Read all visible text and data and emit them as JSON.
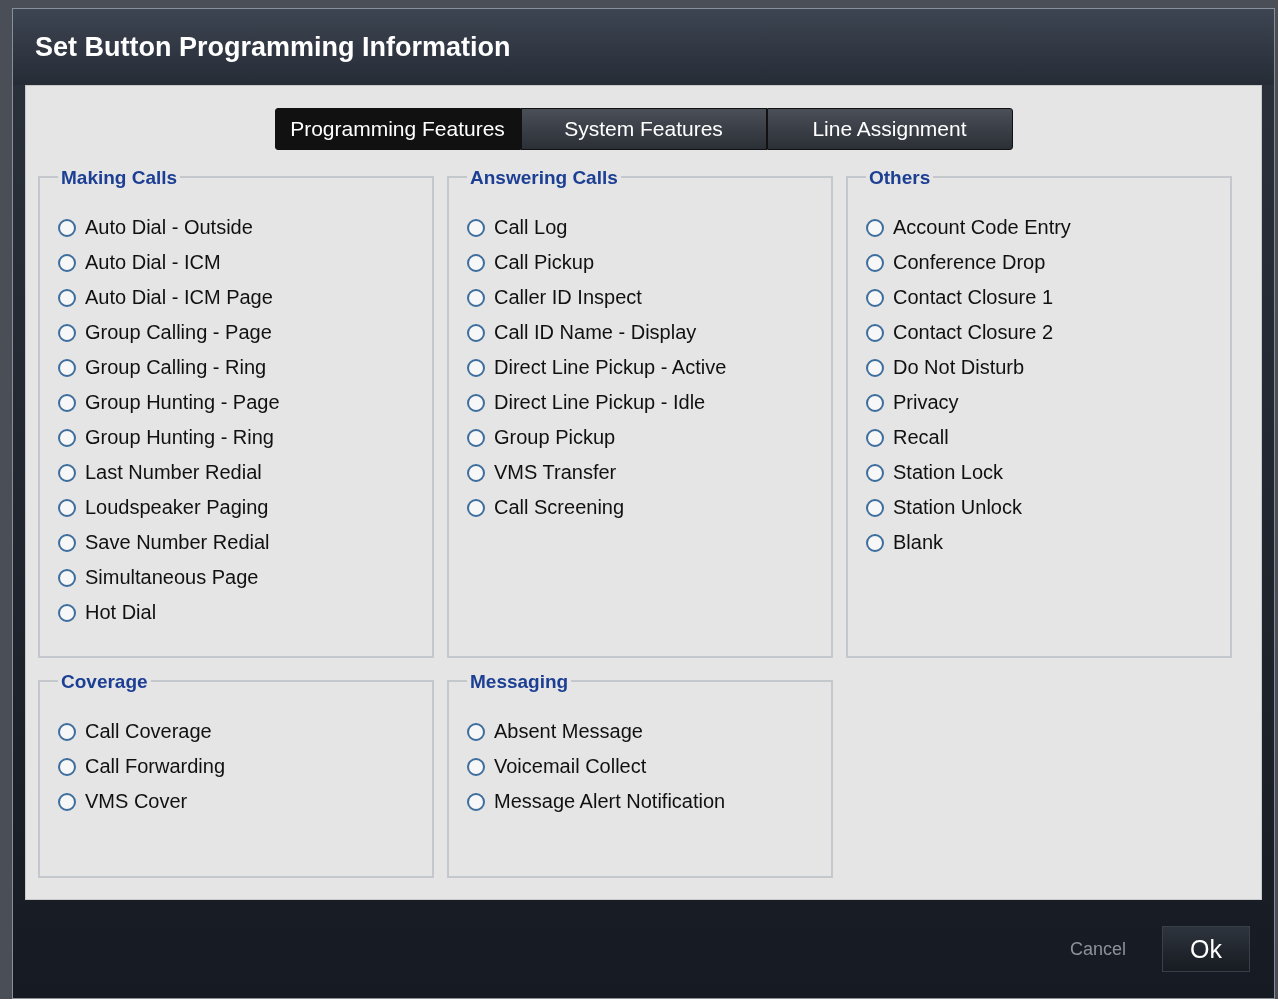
{
  "dialog": {
    "title": "Set Button Programming Information"
  },
  "tabs": [
    {
      "label": "Programming Features",
      "selected": true
    },
    {
      "label": "System Features",
      "selected": false
    },
    {
      "label": "Line Assignment",
      "selected": false
    }
  ],
  "groups": [
    {
      "title": "Making Calls",
      "options": [
        {
          "label": "Auto Dial - Outside",
          "selected": false
        },
        {
          "label": "Auto Dial - ICM",
          "selected": false
        },
        {
          "label": "Auto Dial - ICM Page",
          "selected": false
        },
        {
          "label": "Group Calling - Page",
          "selected": false
        },
        {
          "label": "Group Calling - Ring",
          "selected": false
        },
        {
          "label": "Group Hunting - Page",
          "selected": false
        },
        {
          "label": "Group Hunting - Ring",
          "selected": false
        },
        {
          "label": "Last Number Redial",
          "selected": false
        },
        {
          "label": "Loudspeaker Paging",
          "selected": false
        },
        {
          "label": "Save Number Redial",
          "selected": false
        },
        {
          "label": "Simultaneous Page",
          "selected": false
        },
        {
          "label": "Hot Dial",
          "selected": false
        }
      ]
    },
    {
      "title": "Answering Calls",
      "options": [
        {
          "label": "Call Log",
          "selected": false
        },
        {
          "label": "Call Pickup",
          "selected": false
        },
        {
          "label": "Caller ID Inspect",
          "selected": false
        },
        {
          "label": "Call ID Name - Display",
          "selected": false
        },
        {
          "label": "Direct Line Pickup - Active",
          "selected": false
        },
        {
          "label": "Direct Line Pickup - Idle",
          "selected": false
        },
        {
          "label": "Group Pickup",
          "selected": false
        },
        {
          "label": "VMS Transfer",
          "selected": false
        },
        {
          "label": "Call Screening",
          "selected": false
        }
      ]
    },
    {
      "title": "Others",
      "options": [
        {
          "label": "Account Code Entry",
          "selected": false
        },
        {
          "label": "Conference Drop",
          "selected": false
        },
        {
          "label": "Contact Closure 1",
          "selected": false
        },
        {
          "label": "Contact Closure 2",
          "selected": false
        },
        {
          "label": "Do Not Disturb",
          "selected": false
        },
        {
          "label": "Privacy",
          "selected": false
        },
        {
          "label": "Recall",
          "selected": false
        },
        {
          "label": "Station Lock",
          "selected": false
        },
        {
          "label": "Station Unlock",
          "selected": false
        },
        {
          "label": "Blank",
          "selected": false
        }
      ]
    },
    {
      "title": "Coverage",
      "options": [
        {
          "label": "Call Coverage",
          "selected": false
        },
        {
          "label": "Call Forwarding",
          "selected": false
        },
        {
          "label": "VMS Cover",
          "selected": false
        }
      ]
    },
    {
      "title": "Messaging",
      "options": [
        {
          "label": "Absent Message",
          "selected": false
        },
        {
          "label": "Voicemail Collect",
          "selected": false
        },
        {
          "label": "Message Alert Notification",
          "selected": false
        }
      ]
    }
  ],
  "buttons": {
    "cancel": "Cancel",
    "ok": "Ok"
  }
}
